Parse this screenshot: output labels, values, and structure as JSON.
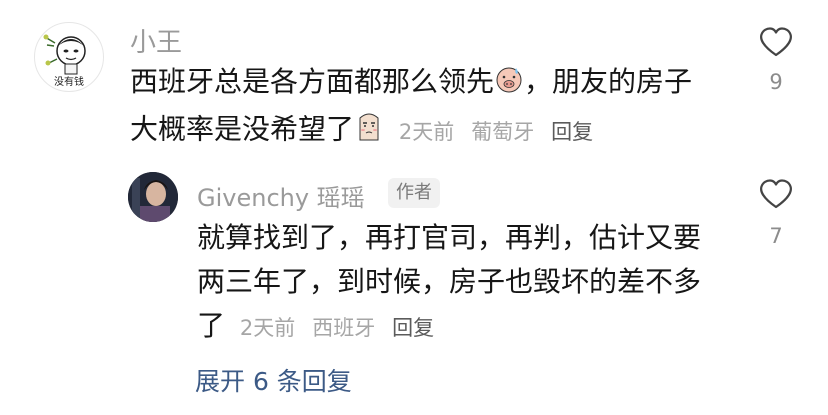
{
  "comment": {
    "avatar_caption": "没有钱",
    "username": "小王",
    "line1": "西班牙总是各方面都那么领先",
    "line1_tail": "，朋友的房子",
    "line2": "大概率是没希望了",
    "time": "2天前",
    "location": "葡萄牙",
    "reply_label": "回复",
    "like_count": "9"
  },
  "reply": {
    "username": "Givenchy 瑶瑶",
    "badge": "作者",
    "line1": "就算找到了，再打官司，再判，估计又要",
    "line2": "两三年了，到时候，房子也毁坏的差不多",
    "line3": "了",
    "time": "2天前",
    "location": "西班牙",
    "reply_label": "回复",
    "like_count": "7"
  },
  "expand_label": "展开 6 条回复",
  "icons": {
    "heart": "heart-outline-icon",
    "emoji1": "sweating-pig-emoji",
    "emoji2": "side-eye-face-emoji"
  },
  "colors": {
    "text": "#161616",
    "name": "#9a9a9a",
    "meta": "#a6a6a6",
    "link": "#3c5a86"
  }
}
